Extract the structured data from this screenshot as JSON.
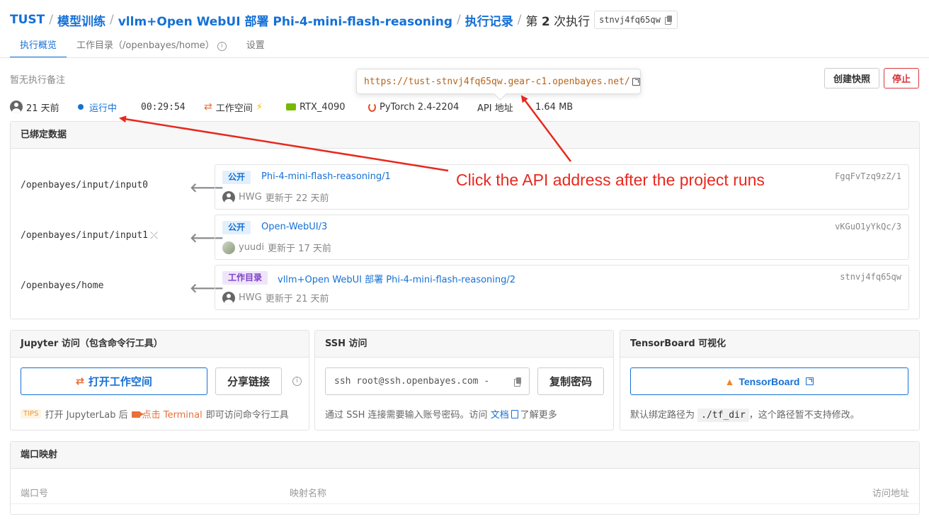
{
  "breadcrumb": {
    "org": "TUST",
    "section": "模型训练",
    "project": "vllm+Open WebUI 部署 Phi-4-mini-flash-reasoning",
    "records": "执行记录",
    "current_prefix": "第",
    "current_num": "2",
    "current_suffix": "次执行",
    "run_id": "stnvj4fq65qw"
  },
  "tabs": [
    {
      "label": "执行概览",
      "active": true
    },
    {
      "label": "工作目录（/openbayes/home）"
    },
    {
      "label": "设置"
    }
  ],
  "note": "暂无执行备注",
  "tooltip_url": "https://tust-stnvj4fq65qw.gear-c1.openbayes.net/",
  "actions": {
    "snapshot": "创建快照",
    "stop": "停止"
  },
  "status": {
    "created": "21 天前",
    "state": "运行中",
    "duration": "00:29:54",
    "workspace": "工作空间",
    "gpu": "RTX_4090",
    "image": "PyTorch 2.4-2204",
    "api": "API 地址",
    "size": "1.64 MB"
  },
  "bound": {
    "title": "已绑定数据",
    "rows": [
      {
        "path": "/openbayes/input/input0",
        "tag": "公开",
        "name": "Phi-4-mini-flash-reasoning/1",
        "id": "FgqFvTzq9zZ/1",
        "user": "HWG",
        "updated": "更新于 22 天前"
      },
      {
        "path": "/openbayes/input/input1",
        "tag": "公开",
        "name": "Open-WebUI/3",
        "id": "vKGuO1yYkQc/3",
        "user": "yuudi",
        "updated": "更新于 17 天前"
      },
      {
        "path": "/openbayes/home",
        "tag": "工作目录",
        "name": "vllm+Open WebUI 部署 Phi-4-mini-flash-reasoning/2",
        "id": "stnvj4fq65qw",
        "user": "HWG",
        "updated": "更新于 21 天前"
      }
    ]
  },
  "jupyter": {
    "title": "Jupyter 访问（包含命令行工具）",
    "open": "打开工作空间",
    "share": "分享链接",
    "tips_tag": "TIPS",
    "tips_a": "打开 JupyterLab 后",
    "tips_b": "点击 Terminal",
    "tips_c": "即可访问命令行工具"
  },
  "ssh": {
    "title": "SSH 访问",
    "command": "ssh root@ssh.openbayes.com -",
    "copy_pw": "复制密码",
    "help_a": "通过 SSH 连接需要输入账号密码。访问",
    "help_link": "文档",
    "help_b": "了解更多"
  },
  "tensorboard": {
    "title": "TensorBoard 可视化",
    "button": "TensorBoard",
    "help_a": "默认绑定路径为",
    "path": "./tf_dir",
    "help_b": "，这个路径暂不支持修改。"
  },
  "ports": {
    "title": "端口映射",
    "cols": [
      "端口号",
      "映射名称",
      "访问地址"
    ]
  },
  "annotation": "Click the API address after the project runs",
  "colors": {
    "accent": "#1570d6",
    "stop": "#d9363e",
    "annotation": "#e8281e"
  }
}
